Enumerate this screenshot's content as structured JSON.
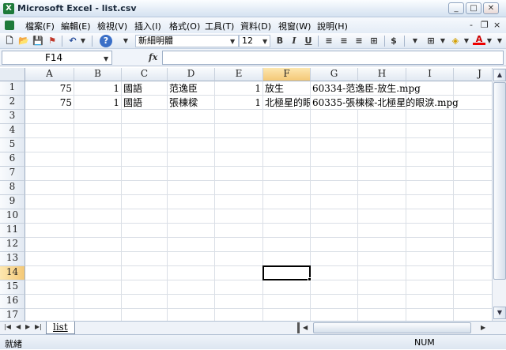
{
  "window": {
    "app_icon": "X",
    "title": "Microsoft Excel - list.csv"
  },
  "menu": {
    "items": [
      "檔案(F)",
      "編輯(E)",
      "檢視(V)",
      "插入(I)",
      "格式(O)",
      "工具(T)",
      "資料(D)",
      "視窗(W)",
      "說明(H)"
    ],
    "doc_controls": [
      "-",
      "❐",
      "×"
    ]
  },
  "toolbar": {
    "font_name": "新細明體",
    "font_size": "12",
    "bold": "B",
    "italic": "I",
    "underline": "U",
    "currency": "$",
    "undo_icon": "undo-icon",
    "help_icon": "help-icon"
  },
  "formula_bar": {
    "name_box": "F14",
    "fx": "fx",
    "content": ""
  },
  "grid": {
    "columns": [
      "A",
      "B",
      "C",
      "D",
      "E",
      "F",
      "G",
      "H",
      "I",
      "J"
    ],
    "rows": [
      "1",
      "2",
      "3",
      "4",
      "5",
      "6",
      "7",
      "8",
      "9",
      "10",
      "11",
      "12",
      "13",
      "14",
      "15",
      "16",
      "17"
    ],
    "active_column": "F",
    "active_row": "14",
    "cells": [
      {
        "row": 1,
        "col": "A",
        "value": "75",
        "align": "right"
      },
      {
        "row": 1,
        "col": "B",
        "value": "1",
        "align": "right"
      },
      {
        "row": 1,
        "col": "C",
        "value": "國語",
        "align": "left"
      },
      {
        "row": 1,
        "col": "D",
        "value": "范逸臣",
        "align": "left"
      },
      {
        "row": 1,
        "col": "E",
        "value": "1",
        "align": "right"
      },
      {
        "row": 1,
        "col": "F",
        "value": "放生",
        "align": "left"
      },
      {
        "row": 1,
        "col": "G",
        "value": "60334-范逸臣-放生.mpg",
        "align": "left"
      },
      {
        "row": 2,
        "col": "A",
        "value": "75",
        "align": "right"
      },
      {
        "row": 2,
        "col": "B",
        "value": "1",
        "align": "right"
      },
      {
        "row": 2,
        "col": "C",
        "value": "國語",
        "align": "left"
      },
      {
        "row": 2,
        "col": "D",
        "value": "張棟樑",
        "align": "left"
      },
      {
        "row": 2,
        "col": "E",
        "value": "1",
        "align": "right"
      },
      {
        "row": 2,
        "col": "F",
        "value": "北極星的眼淚",
        "align": "left"
      },
      {
        "row": 2,
        "col": "G",
        "value": "60335-張棟樑-北極星的眼淚.mpg",
        "align": "left"
      }
    ]
  },
  "sheets": {
    "tabs": [
      "list"
    ]
  },
  "status": {
    "text": "就緒",
    "num": "NUM"
  }
}
